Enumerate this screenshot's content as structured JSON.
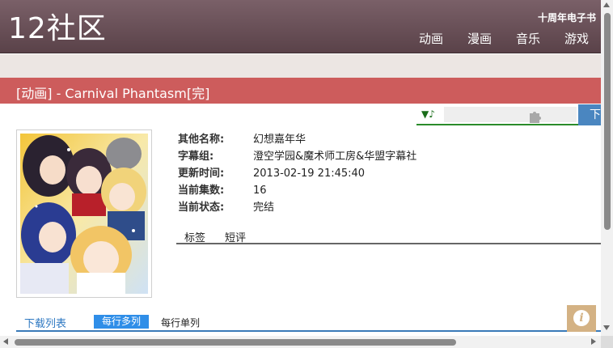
{
  "site": {
    "logo": "12社区",
    "anniversary_link": "十周年电子书",
    "nav": [
      "动画",
      "漫画",
      "音乐",
      "游戏"
    ]
  },
  "page": {
    "title": "[动画] - Carnival Phantasm[完]"
  },
  "player": {
    "volume_icon": "▼♪",
    "plugin_icon": "puzzle-icon",
    "download_label": "下"
  },
  "info": {
    "rows": [
      {
        "label": "其他名称:",
        "value": "幻想嘉年华"
      },
      {
        "label": "字幕组:",
        "value": "澄空学园&魔术师工房&华盟字幕社"
      },
      {
        "label": "更新时间:",
        "value": "2013-02-19 21:45:40"
      },
      {
        "label": "当前集数:",
        "value": "16"
      },
      {
        "label": "当前状态:",
        "value": "完结"
      }
    ],
    "tabs": [
      "标签",
      "短评"
    ]
  },
  "downloads": {
    "tab_label": "下载列表",
    "mode_multi": "每行多列",
    "mode_single": "每行单列"
  },
  "colors": {
    "header": "#6b5158",
    "title_bar": "#cd5c5c",
    "accent_blue": "#2f8ee8",
    "info_button": "#d4b284"
  },
  "info_button_icon": "i"
}
